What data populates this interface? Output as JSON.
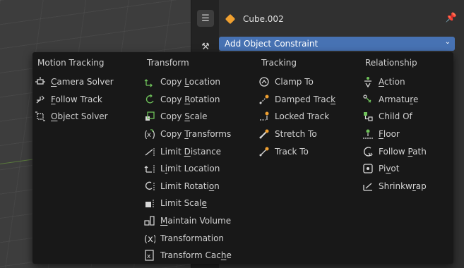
{
  "properties": {
    "object_name": "Cube.002",
    "add_constraint_label": "Add Object Constraint"
  },
  "menu": {
    "columns": [
      {
        "header": "Motion Tracking",
        "items": [
          {
            "label": "Camera Solver",
            "icon": "camera-solver-icon"
          },
          {
            "label": "Follow Track",
            "icon": "follow-track-icon"
          },
          {
            "label": "Object Solver",
            "icon": "object-solver-icon"
          }
        ]
      },
      {
        "header": "Transform",
        "items": [
          {
            "label": "Copy Location",
            "icon": "copy-location-icon"
          },
          {
            "label": "Copy Rotation",
            "icon": "copy-rotation-icon"
          },
          {
            "label": "Copy Scale",
            "icon": "copy-scale-icon"
          },
          {
            "label": "Copy Transforms",
            "icon": "copy-transforms-icon"
          },
          {
            "label": "Limit Distance",
            "icon": "limit-distance-icon"
          },
          {
            "label": "Limit Location",
            "icon": "limit-location-icon"
          },
          {
            "label": "Limit Rotation",
            "icon": "limit-rotation-icon"
          },
          {
            "label": "Limit Scale",
            "icon": "limit-scale-icon"
          },
          {
            "label": "Maintain Volume",
            "icon": "maintain-volume-icon"
          },
          {
            "label": "Transformation",
            "icon": "transformation-icon"
          },
          {
            "label": "Transform Cache",
            "icon": "transform-cache-icon"
          }
        ]
      },
      {
        "header": "Tracking",
        "items": [
          {
            "label": "Clamp To",
            "icon": "clamp-to-icon"
          },
          {
            "label": "Damped Track",
            "icon": "damped-track-icon"
          },
          {
            "label": "Locked Track",
            "icon": "locked-track-icon"
          },
          {
            "label": "Stretch To",
            "icon": "stretch-to-icon"
          },
          {
            "label": "Track To",
            "icon": "track-to-icon"
          }
        ]
      },
      {
        "header": "Relationship",
        "items": [
          {
            "label": "Action",
            "icon": "action-icon"
          },
          {
            "label": "Armature",
            "icon": "armature-icon"
          },
          {
            "label": "Child Of",
            "icon": "child-of-icon"
          },
          {
            "label": "Floor",
            "icon": "floor-icon"
          },
          {
            "label": "Follow Path",
            "icon": "follow-path-icon"
          },
          {
            "label": "Pivot",
            "icon": "pivot-icon"
          },
          {
            "label": "Shrinkwrap",
            "icon": "shrinkwrap-icon"
          }
        ]
      }
    ]
  },
  "colors": {
    "accent": "#4772b3",
    "icon_green": "#6fc25a",
    "icon_orange": "#f0a030",
    "menu_bg": "#181818"
  }
}
